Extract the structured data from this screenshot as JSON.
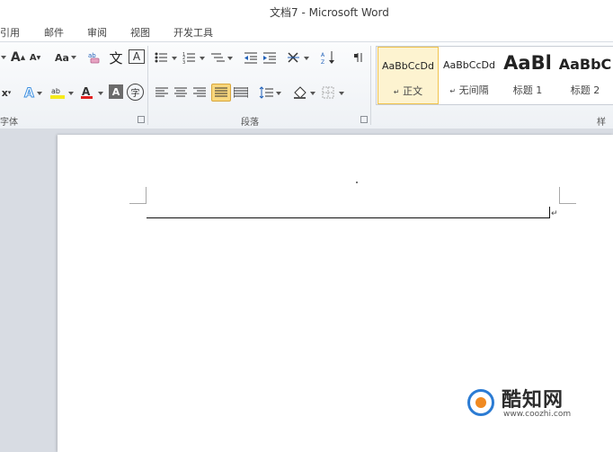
{
  "window": {
    "title": "文档7 - Microsoft Word"
  },
  "menu": [
    "引用",
    "邮件",
    "审阅",
    "视图",
    "开发工具"
  ],
  "ribbon": {
    "font_group_label": "字体",
    "paragraph_group_label": "段落",
    "styles_group_label": "样式",
    "change_case_label": "Aa",
    "font_color_letter": "A",
    "highlight_label": "ab",
    "grow_font_label": "A",
    "shrink_font_label": "A",
    "phonetic_label": "文",
    "border_char_label": "A",
    "char_shading_label": "A",
    "enclose_char_label": "字",
    "clear_format_label": "x",
    "styles": [
      {
        "sample": "AaBbCcDd",
        "name": "正文",
        "active": true,
        "mark": "↵"
      },
      {
        "sample": "AaBbCcDd",
        "name": "无间隔",
        "active": false,
        "mark": "↵"
      },
      {
        "sample": "AaBl",
        "name": "标题 1",
        "active": false
      },
      {
        "sample": "AaBbC",
        "name": "标题 2",
        "active": false
      }
    ]
  },
  "document": {
    "paragraph_mark": "↵"
  },
  "watermark": {
    "title": "酷知网",
    "url": "www.coozhi.com"
  }
}
